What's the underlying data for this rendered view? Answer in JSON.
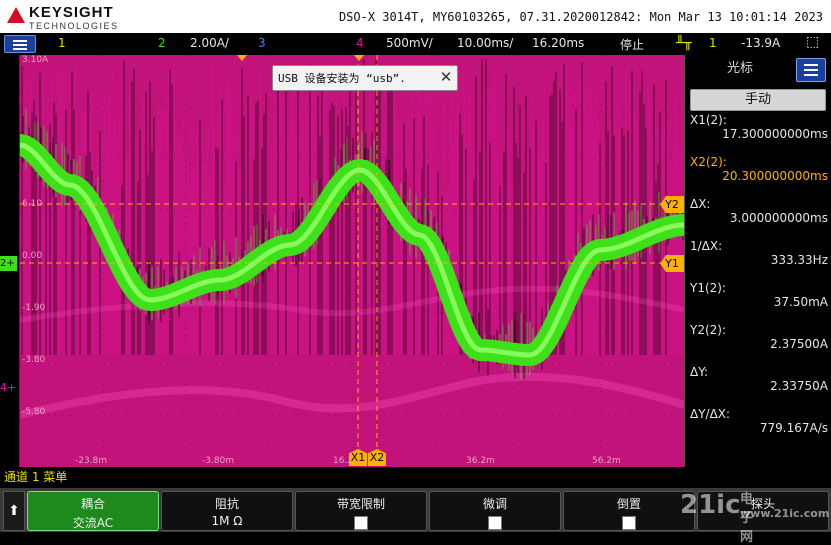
{
  "brand": {
    "name": "KEYSIGHT",
    "subtitle": "TECHNOLOGIES"
  },
  "header": {
    "info": "DSO-X 3014T, MY60103265, 07.31.2020012842: Mon Mar 13 10:01:14 2023"
  },
  "status": {
    "ch1": "1",
    "ch2": "2",
    "ch2_scale": "2.00A/",
    "ch3": "3",
    "ch4": "4",
    "ch4_scale": "500mV/",
    "time_scale": "10.00ms/",
    "delay": "16.20ms",
    "run_state": "停止",
    "trig_src": "1",
    "trig_level": "-13.9A"
  },
  "notification": {
    "text": "USB 设备安装为 “usb”."
  },
  "cursor_panel": {
    "title": "光标",
    "mode": "手动",
    "x1_label": "X1(2):",
    "x1_value": "17.300000000ms",
    "x2_label": "X2(2):",
    "x2_value": "20.300000000ms",
    "dx_label": "ΔX:",
    "dx_value": "3.000000000ms",
    "inv_dx_label": "1/ΔX:",
    "inv_dx_value": "333.33Hz",
    "y1_label": "Y1(2):",
    "y1_value": "37.50mA",
    "y2_label": "Y2(2):",
    "y2_value": "2.37500A",
    "dy_label": "ΔY:",
    "dy_value": "2.33750A",
    "dydx_label": "ΔY/ΔX:",
    "dydx_value": "779.167A/s"
  },
  "graticule": {
    "y_ticks": [
      "3.10A",
      "6.10",
      "0.00",
      "-1.90",
      "-3.80",
      "-5.80"
    ],
    "x_ticks": [
      "-23.8m",
      "-3.80m",
      "16.2",
      "36.2m",
      "56.2m"
    ],
    "cursor_tags": [
      "X1",
      "X2",
      "Y1",
      "Y2"
    ],
    "trace_colors": {
      "ch2": "#3ee01a",
      "ch4": "#e0139a"
    }
  },
  "channel_menu": {
    "title": "通道 1 菜单"
  },
  "softkeys": [
    {
      "label": "耦合",
      "value": "交流AC"
    },
    {
      "label": "阻抗",
      "value": "1M Ω"
    },
    {
      "label": "带宽限制",
      "value": ""
    },
    {
      "label": "微调",
      "value": ""
    },
    {
      "label": "倒置",
      "value": ""
    },
    {
      "label": "探头",
      "value": ""
    }
  ],
  "watermark": {
    "main": "21ic",
    "top": "电子网",
    "bottom": "www.21ic.com"
  }
}
